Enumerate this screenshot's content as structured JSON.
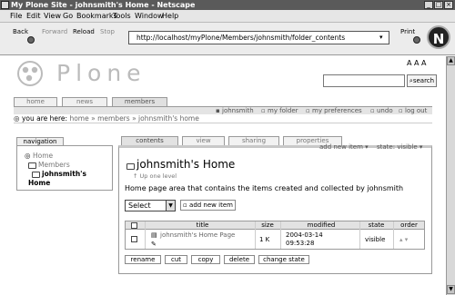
{
  "window": {
    "title": "My Plone Site - johnsmith's Home - Netscape",
    "controls": [
      "_",
      "□",
      "×"
    ]
  },
  "menubar": {
    "items": [
      "File",
      "Edit",
      "View",
      "Go",
      "Bookmarks",
      "Tools",
      "Window",
      "Help"
    ]
  },
  "navbar": {
    "back": "Back",
    "forward": "Forward",
    "reload": "Reload",
    "stop": "Stop",
    "print": "Print",
    "url": "http://localhost/myPlone/Members/johnsmith/folder_contents",
    "brand_letter": "N"
  },
  "plone": {
    "logo_text": "Plone",
    "font_sizes": "A A A",
    "search_button": "search",
    "global_tabs": [
      "home",
      "news",
      "members"
    ],
    "personal_bar": [
      "johnsmith",
      "my folder",
      "my preferences",
      "undo",
      "log out"
    ],
    "breadcrumb": {
      "prefix": "you are here:",
      "home": "home",
      "members": "members",
      "current": "johnsmith's home",
      "sep": "»"
    }
  },
  "navigation": {
    "title": "navigation",
    "items": [
      "Home",
      "Members",
      "johnsmith's",
      "Home"
    ]
  },
  "content": {
    "tabs": [
      "contents",
      "view",
      "sharing",
      "properties"
    ],
    "actions": [
      "add new item ▾",
      "state: visible ▾"
    ],
    "title": "johnsmith's Home",
    "up_level": "Up one level",
    "description": "Home page area that contains the items created and collected by johnsmith",
    "select_value": "Select",
    "add_button": "add new item"
  },
  "table": {
    "headers": [
      "title",
      "size",
      "modified",
      "state",
      "order"
    ],
    "row": {
      "title": "johnsmith's Home Page",
      "size": "1 K",
      "modified_date": "2004-03-14",
      "modified_time": "09:53:28",
      "state": "visible",
      "order": "▴ ▾"
    }
  },
  "buttons": [
    "rename",
    "cut",
    "copy",
    "delete",
    "change state"
  ]
}
